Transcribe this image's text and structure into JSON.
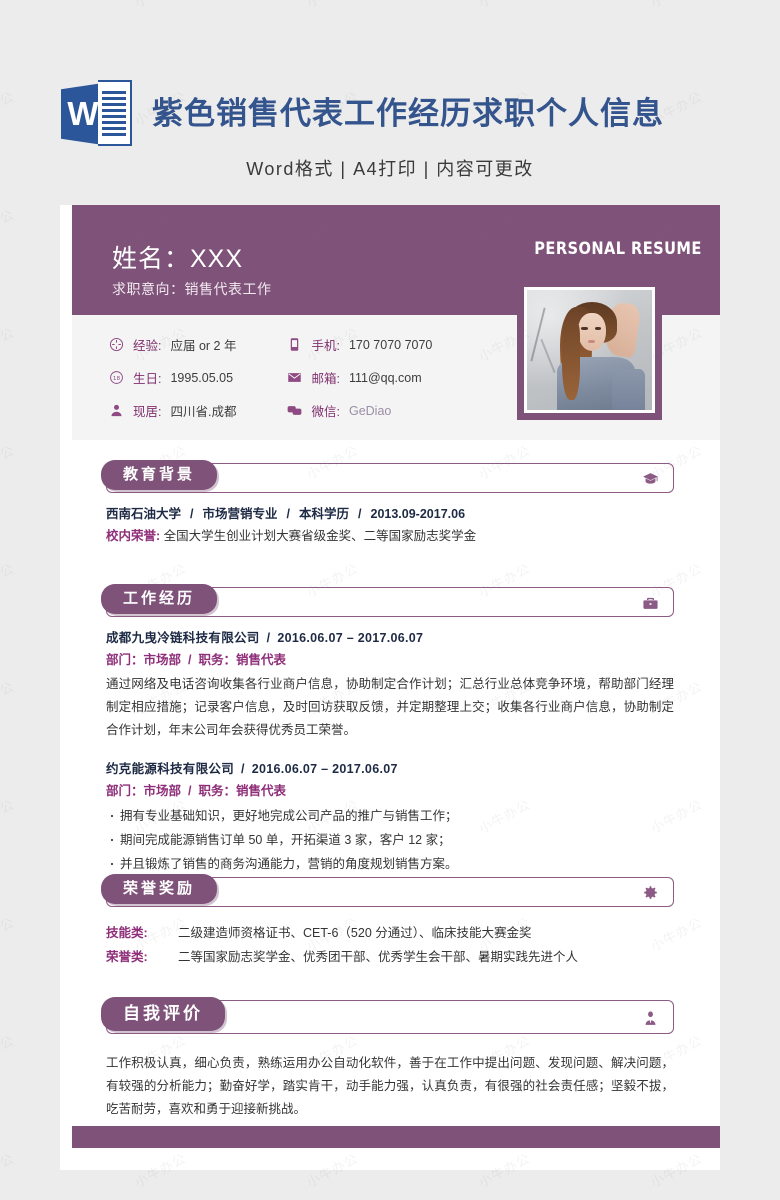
{
  "promo": {
    "logo_letter": "W",
    "title": "紫色销售代表工作经历求职个人信息",
    "subtitle": "Word格式 | A4打印 | 内容可更改"
  },
  "resume": {
    "banner": {
      "name": "姓名：XXX",
      "intent": "求职意向：销售代表工作",
      "english_title": "PERSONAL RESUME"
    },
    "contact": {
      "left": [
        {
          "icon": "compass-icon",
          "label": "经验:",
          "value": "应届 or 2 年"
        },
        {
          "icon": "birthday-18-icon",
          "label": "生日:",
          "value": "1995.05.05"
        },
        {
          "icon": "location-person-icon",
          "label": "现居:",
          "value": "四川省.成都"
        }
      ],
      "right": [
        {
          "icon": "mobile-phone-icon",
          "label": "手机:",
          "value": "170 7070 7070"
        },
        {
          "icon": "envelope-icon",
          "label": "邮箱:",
          "value": "111@qq.com"
        },
        {
          "icon": "wechat-icon",
          "label": "微信:",
          "value": "GeDiao",
          "muted": true
        }
      ]
    },
    "sections": {
      "education": {
        "title": "教育背景",
        "icon": "graduation-cap-icon",
        "line": [
          "西南石油大学",
          "市场营销专业",
          "本科学历",
          "2013.09-2017.06"
        ],
        "honor_key": "校内荣誉:",
        "honor_val": "全国大学生创业计划大赛省级金奖、二等国家励志奖学金"
      },
      "work": {
        "title": "工作经历",
        "icon": "briefcase-icon",
        "entries": [
          {
            "company": "成都九曳冷链科技有限公司",
            "date": "2016.06.07 – 2017.06.07",
            "dept": "部门：市场部",
            "role": "职务：销售代表",
            "paragraph": "通过网络及电话咨询收集各行业商户信息，协助制定合作计划；汇总行业总体竞争环境，帮助部门经理制定相应措施；记录客户信息，及时回访获取反馈，并定期整理上交；收集各行业商户信息，协助制定合作计划，年末公司年会获得优秀员工荣誉。"
          },
          {
            "company": "约克能源科技有限公司",
            "date": "2016.06.07 – 2017.06.07",
            "dept": "部门：市场部",
            "role": "职务：销售代表",
            "bullets": [
              "拥有专业基础知识，更好地完成公司产品的推广与销售工作；",
              "期间完成能源销售订单 50 单，开拓渠道 3 家，客户 12 家；",
              "并且锻炼了销售的商务沟通能力，营销的角度规划销售方案。"
            ]
          }
        ]
      },
      "honors": {
        "title": "荣誉奖励",
        "icon": "gear-icon",
        "rows": [
          {
            "key": "技能类:",
            "val": "二级建造师资格证书、CET-6（520 分通过）、临床技能大赛金奖"
          },
          {
            "key": "荣誉类:",
            "val": "二等国家励志奖学金、优秀团干部、优秀学生会干部、暑期实践先进个人"
          }
        ]
      },
      "self": {
        "title": "自我评价",
        "icon": "person-tie-icon",
        "paragraph": "工作积极认真，细心负责，熟练运用办公自动化软件，善于在工作中提出问题、发现问题、解决问题，有较强的分析能力；勤奋好学，踏实肯干，动手能力强，认真负责，有很强的社会责任感；坚毅不拔，吃苦耐劳，喜欢和勇于迎接新挑战。"
      }
    }
  },
  "colors": {
    "purple": "#7f5279",
    "purple_text": "#8f2f7a",
    "word_blue": "#2b579a",
    "title_blue": "#33548c",
    "dark_navy": "#1e2a44",
    "page_bg": "#ececec"
  },
  "watermark_text": "小牛办公"
}
